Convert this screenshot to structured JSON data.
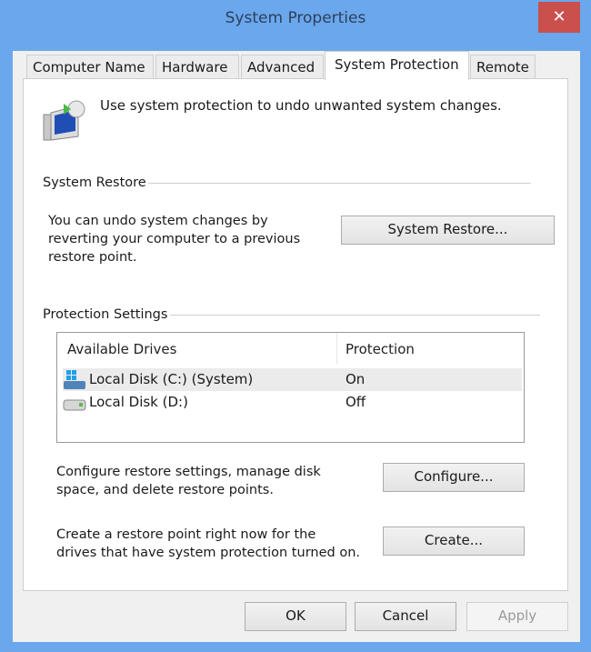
{
  "window": {
    "title": "System Properties",
    "close": "✕"
  },
  "tabs": [
    {
      "label": "Computer Name"
    },
    {
      "label": "Hardware"
    },
    {
      "label": "Advanced"
    },
    {
      "label": "System Protection",
      "active": true
    },
    {
      "label": "Remote"
    }
  ],
  "intro": "Use system protection to undo unwanted system changes.",
  "system_restore": {
    "heading": "System Restore",
    "text": [
      "You can undo system changes by",
      "reverting your computer to a previous",
      "restore point."
    ],
    "button": "System Restore..."
  },
  "protection": {
    "heading": "Protection Settings",
    "columns": [
      "Available Drives",
      "Protection"
    ],
    "drives": [
      {
        "name": "Local Disk (C:) (System)",
        "protection": "On",
        "icon": "system-drive-icon"
      },
      {
        "name": "Local Disk (D:)",
        "protection": "Off",
        "icon": "drive-icon"
      }
    ],
    "configure_text": [
      "Configure restore settings, manage disk",
      "space, and delete restore points."
    ],
    "configure_button": "Configure...",
    "create_text": [
      "Create a restore point right now for the",
      "drives that have system protection turned on."
    ],
    "create_button": "Create..."
  },
  "footer": {
    "ok": "OK",
    "cancel": "Cancel",
    "apply": "Apply"
  }
}
